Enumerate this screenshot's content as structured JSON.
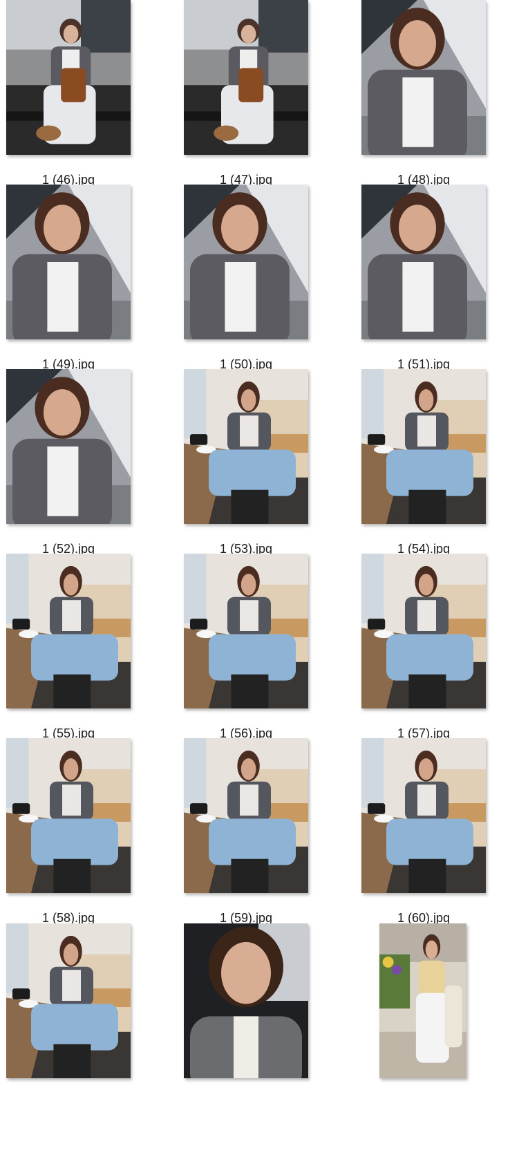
{
  "files": [
    {
      "name": "1 (46).jpg",
      "scene": "outdoor-bench"
    },
    {
      "name": "1 (47).jpg",
      "scene": "outdoor-bench"
    },
    {
      "name": "1 (48).jpg",
      "scene": "outdoor-selfie"
    },
    {
      "name": "1 (49).jpg",
      "scene": "outdoor-selfie"
    },
    {
      "name": "1 (50).jpg",
      "scene": "outdoor-selfie"
    },
    {
      "name": "1 (51).jpg",
      "scene": "outdoor-selfie"
    },
    {
      "name": "1 (52).jpg",
      "scene": "outdoor-selfie"
    },
    {
      "name": "1 (53).jpg",
      "scene": "cafe"
    },
    {
      "name": "1 (54).jpg",
      "scene": "cafe"
    },
    {
      "name": "1 (55).jpg",
      "scene": "cafe"
    },
    {
      "name": "1 (56).jpg",
      "scene": "cafe"
    },
    {
      "name": "1 (57).jpg",
      "scene": "cafe"
    },
    {
      "name": "1 (58).jpg",
      "scene": "cafe"
    },
    {
      "name": "1 (59).jpg",
      "scene": "cafe"
    },
    {
      "name": "1 (60).jpg",
      "scene": "cafe"
    },
    {
      "name": "",
      "scene": "cafe"
    },
    {
      "name": "",
      "scene": "car-selfie"
    },
    {
      "name": "",
      "scene": "flower-terrace"
    }
  ]
}
